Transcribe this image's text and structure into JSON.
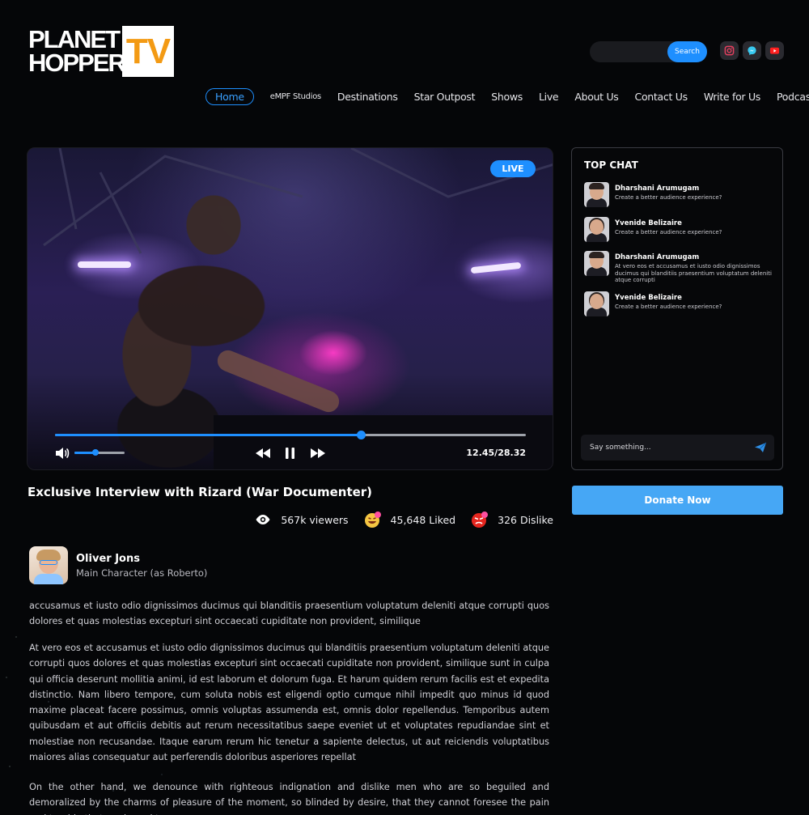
{
  "logo": {
    "line1": "PLANET",
    "line2": "HOPPER",
    "tv": "TV"
  },
  "search": {
    "placeholder": "",
    "button_label": "Search"
  },
  "social": [
    "instagram-icon",
    "messenger-icon",
    "youtube-icon"
  ],
  "nav": [
    "Home",
    "eMPF Studios",
    "Destinations",
    "Star Outpost",
    "Shows",
    "Live",
    "About Us",
    "Contact Us",
    "Write for Us",
    "Podcasts"
  ],
  "video": {
    "badge": "LIVE",
    "time": "12.45/28.32",
    "progress": 0.65,
    "volume": 0.42
  },
  "title": "Exclusive Interview with Rizard (War Documenter)",
  "stats": {
    "viewers": "567k viewers",
    "liked": "45,648 Liked",
    "dislike": "326 Dislike"
  },
  "author": {
    "name": "Oliver Jons",
    "role": "Main Character (as Roberto)"
  },
  "paragraphs": [
    " accusamus et iusto odio dignissimos ducimus qui blanditiis praesentium voluptatum deleniti atque corrupti quos dolores et quas molestias excepturi sint occaecati cupiditate non provident, similique",
    "At vero eos et accusamus et iusto odio dignissimos ducimus qui blanditiis praesentium voluptatum deleniti atque corrupti quos dolores et quas molestias excepturi sint occaecati cupiditate non provident, similique sunt in culpa qui officia deserunt mollitia animi, id est laborum et dolorum fuga. Et harum quidem rerum facilis est et expedita distinctio. Nam libero tempore, cum soluta nobis est eligendi optio cumque nihil impedit quo minus id quod maxime placeat facere possimus, omnis voluptas assumenda est, omnis dolor repellendus. Temporibus autem quibusdam et aut officiis debitis aut rerum necessitatibus saepe eveniet ut et voluptates repudiandae sint et molestiae non recusandae. Itaque earum rerum hic tenetur a sapiente delectus, ut aut reiciendis voluptatibus maiores alias consequatur aut perferendis doloribus asperiores repellat",
    "On the other hand, we denounce with righteous indignation and dislike men who are so beguiled and demoralized by the charms of pleasure of the moment, so blinded by desire, that they cannot foresee the pain and trouble that are bound to"
  ],
  "chat": {
    "title": "TOP CHAT",
    "messages": [
      {
        "name": "Dharshani Arumugam",
        "text": "Create a better audience experience?"
      },
      {
        "name": "Yvenide Belizaire",
        "text": "Create a better audience experience?"
      },
      {
        "name": "Dharshani Arumugam",
        "text": "At vero eos et accusamus et iusto odio dignissimos ducimus qui blanditiis praesentium voluptatum deleniti atque corrupti"
      },
      {
        "name": "Yvenide Belizaire",
        "text": "Create a better audience experience?"
      }
    ],
    "input_placeholder": "Say something..."
  },
  "donate_label": "Donate Now",
  "colors": {
    "accent": "#1e8fff",
    "logo_orange": "#f39a14",
    "background": "#050608",
    "donate": "#46a7f5"
  }
}
